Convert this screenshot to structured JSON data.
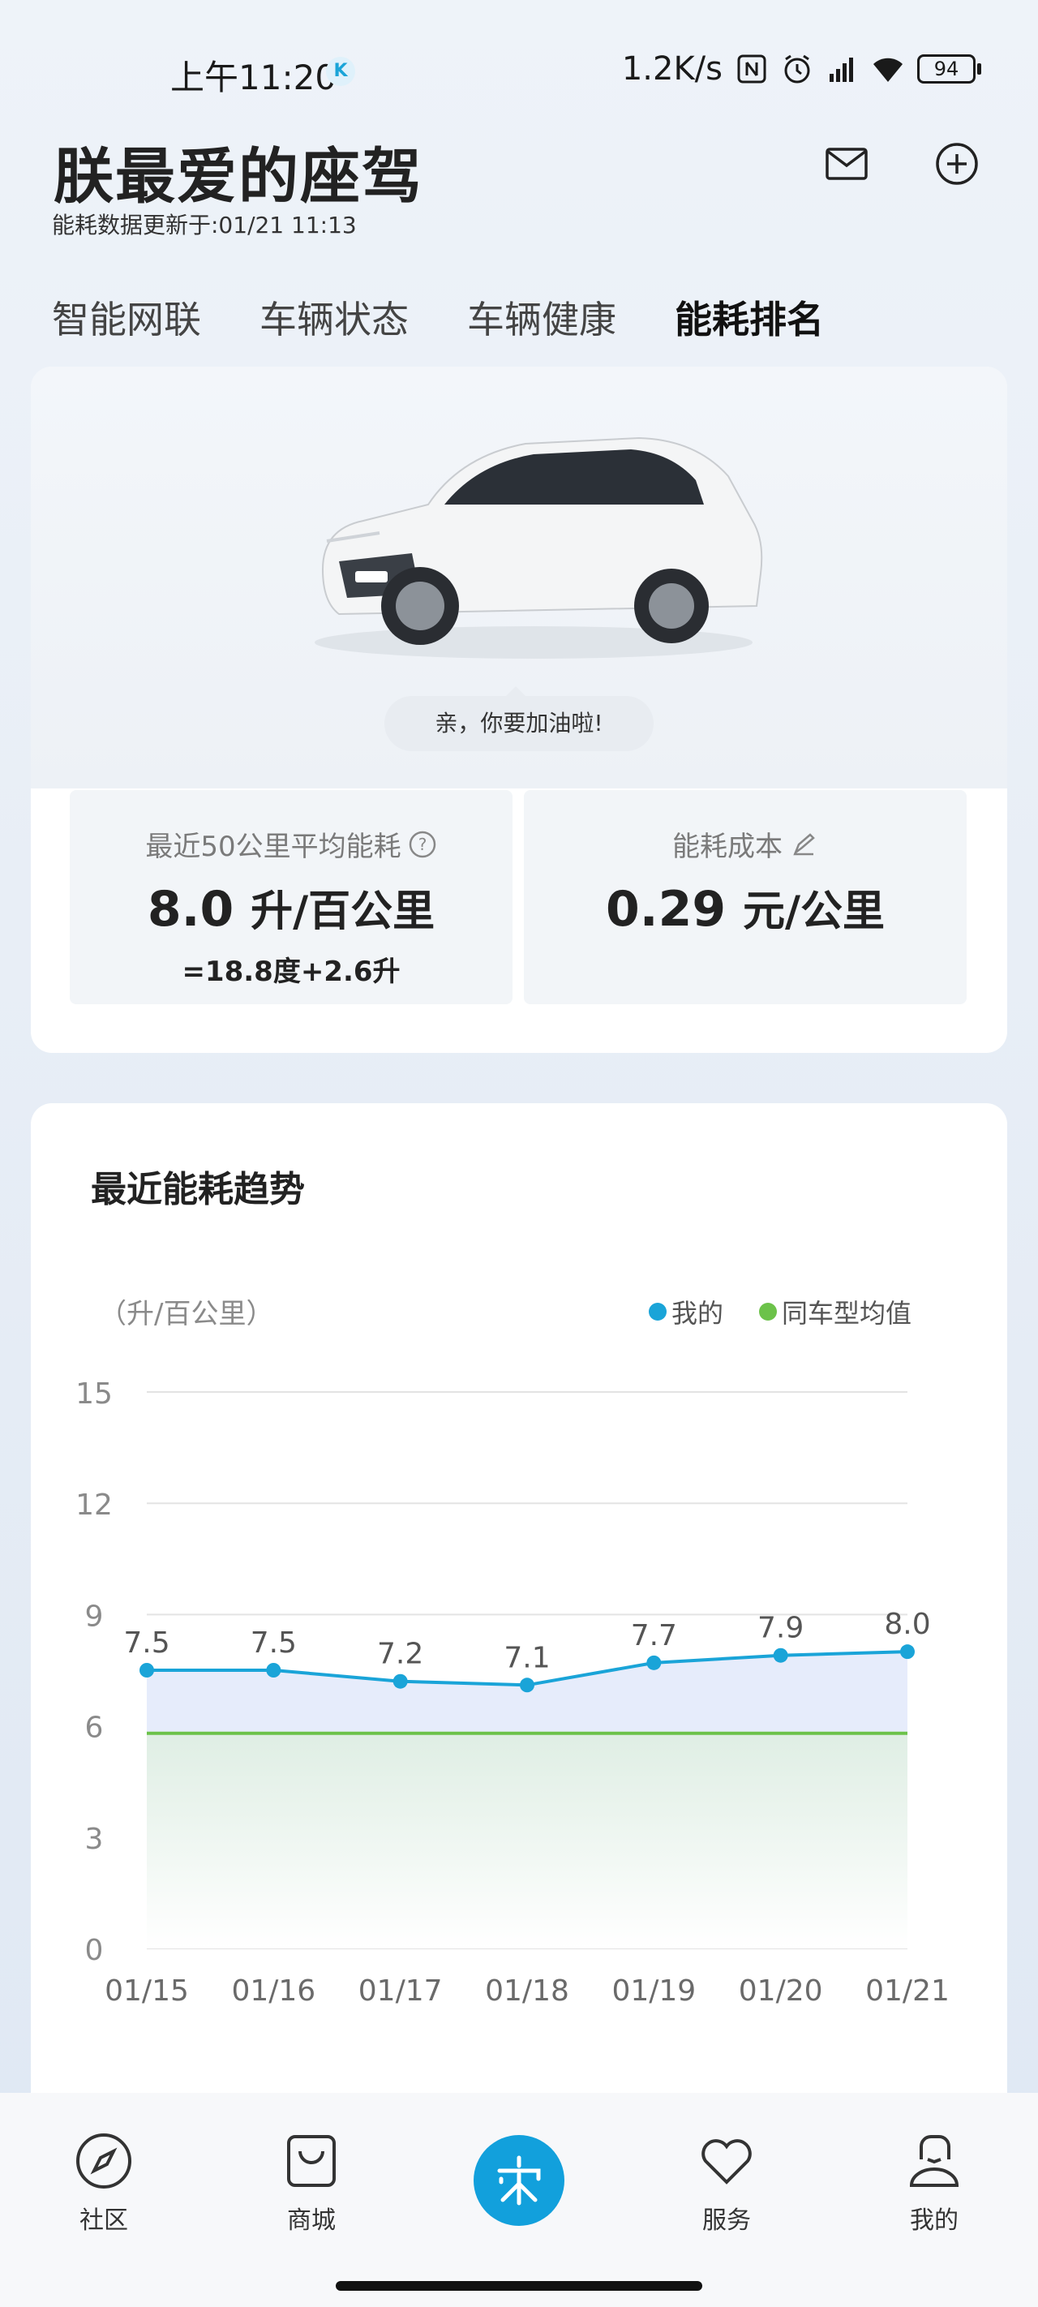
{
  "status_bar": {
    "time": "上午11:20",
    "k_badge": "K",
    "speed": "1.2K/s",
    "battery": "94",
    "icons": [
      "nfc-icon",
      "alarm-icon",
      "signal-icon",
      "wifi-icon",
      "battery-icon"
    ]
  },
  "header": {
    "title": "朕最爱的座驾",
    "subtitle": "能耗数据更新于:01/21 11:13",
    "icons": [
      "mail-icon",
      "add-icon"
    ]
  },
  "tabs": [
    {
      "label": "智能网联",
      "active": false
    },
    {
      "label": "车辆状态",
      "active": false
    },
    {
      "label": "车辆健康",
      "active": false
    },
    {
      "label": "能耗排名",
      "active": true
    }
  ],
  "car_card": {
    "bubble": "亲，你要加油啦!",
    "avg_label": "最近50公里平均能耗",
    "avg_value": "8.0",
    "avg_unit": "升/百公里",
    "avg_sub": "=18.8度+2.6升",
    "cost_label": "能耗成本",
    "cost_value": "0.29",
    "cost_unit": "元/公里"
  },
  "trend_card": {
    "title": "最近能耗趋势",
    "unit": "（升/百公里）"
  },
  "chart_data": {
    "type": "line",
    "categories": [
      "01/15",
      "01/16",
      "01/17",
      "01/18",
      "01/19",
      "01/20",
      "01/21"
    ],
    "series": [
      {
        "name": "我的",
        "values": [
          7.5,
          7.5,
          7.2,
          7.1,
          7.7,
          7.9,
          8.0
        ],
        "color": "#1aa4d8",
        "labels": [
          "7.5",
          "7.5",
          "7.2",
          "7.1",
          "7.7",
          "7.9",
          "8.0"
        ]
      },
      {
        "name": "同车型均值",
        "values": [
          5.8,
          5.8,
          5.8,
          5.8,
          5.8,
          5.8,
          5.8
        ],
        "color": "#6cc24a"
      }
    ],
    "ylabel": "（升/百公里）",
    "ylim": [
      0,
      15
    ],
    "yticks": [
      0,
      3,
      6,
      9,
      12,
      15
    ],
    "grid": true,
    "legend": "top-right"
  },
  "bottom_nav": [
    {
      "label": "社区",
      "icon": "compass-icon"
    },
    {
      "label": "商城",
      "icon": "shopping-bag-icon"
    },
    {
      "label": "",
      "icon": "song-logo-icon"
    },
    {
      "label": "服务",
      "icon": "heart-icon"
    },
    {
      "label": "我的",
      "icon": "profile-icon"
    }
  ]
}
